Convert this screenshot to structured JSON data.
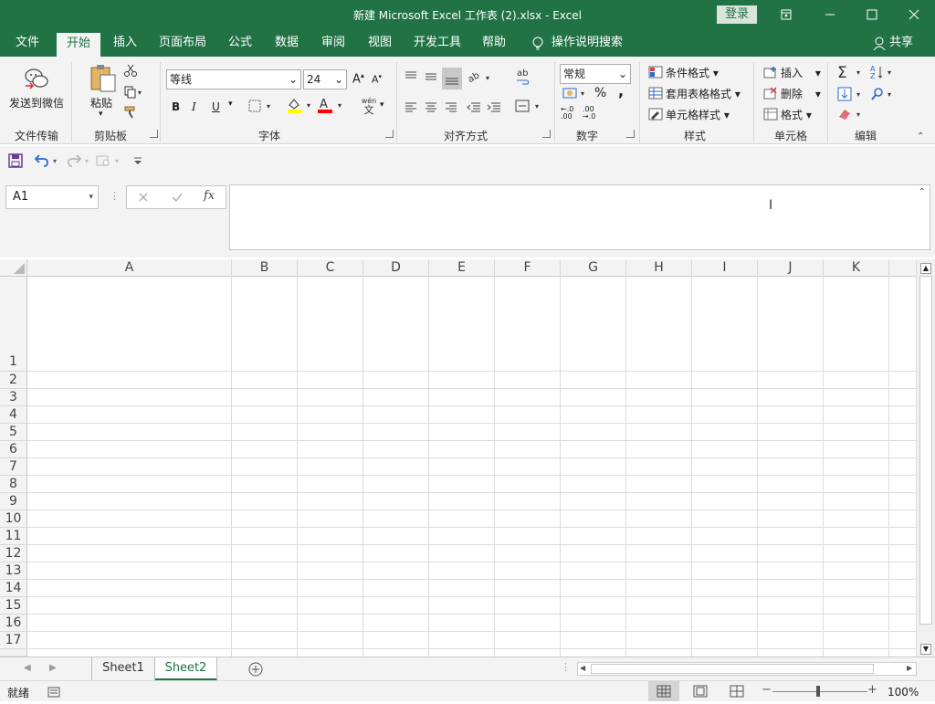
{
  "window": {
    "title": "新建 Microsoft Excel 工作表 (2).xlsx  -  Excel",
    "login": "登录"
  },
  "tabs": [
    "文件",
    "开始",
    "插入",
    "页面布局",
    "公式",
    "数据",
    "审阅",
    "视图",
    "开发工具",
    "帮助"
  ],
  "active_tab": "开始",
  "search_hint": "操作说明搜索",
  "share": "共享",
  "ribbon": {
    "wechat": {
      "label": "发送到微信",
      "group": "文件传输"
    },
    "clipboard": {
      "paste": "粘贴",
      "group": "剪贴板"
    },
    "font": {
      "name": "等线",
      "size": "24",
      "group": "字体",
      "bold": "B",
      "italic": "I",
      "underline": "U",
      "phonetic_top": "wén",
      "phonetic_bottom": "文"
    },
    "align": {
      "group": "对齐方式"
    },
    "number": {
      "format": "常规",
      "group": "数字",
      "percent": "%",
      "comma": ",",
      "inc_decimal": "←.0 .00",
      "dec_decimal": ".00 →.0"
    },
    "styles": {
      "conditional": "条件格式",
      "table": "套用表格格式",
      "cell": "单元格样式",
      "group": "样式"
    },
    "cells": {
      "insert": "插入",
      "delete": "删除",
      "format": "格式",
      "group": "单元格"
    },
    "editing": {
      "group": "编辑"
    }
  },
  "formula": {
    "namebox": "A1",
    "fx": "fx",
    "value": ""
  },
  "columns": [
    "A",
    "B",
    "C",
    "D",
    "E",
    "F",
    "G",
    "H",
    "I",
    "J",
    "K"
  ],
  "rows": [
    "1",
    "2",
    "3",
    "4",
    "5",
    "6",
    "7",
    "8",
    "9",
    "10",
    "11",
    "12",
    "13",
    "14",
    "15",
    "16",
    "17"
  ],
  "sheets": [
    "Sheet1",
    "Sheet2"
  ],
  "active_sheet": "Sheet2",
  "status": {
    "ready": "就绪",
    "zoom": "100%"
  },
  "colors": {
    "accent": "#217346",
    "font_color": "#ff0000",
    "highlight": "#ffff00"
  }
}
